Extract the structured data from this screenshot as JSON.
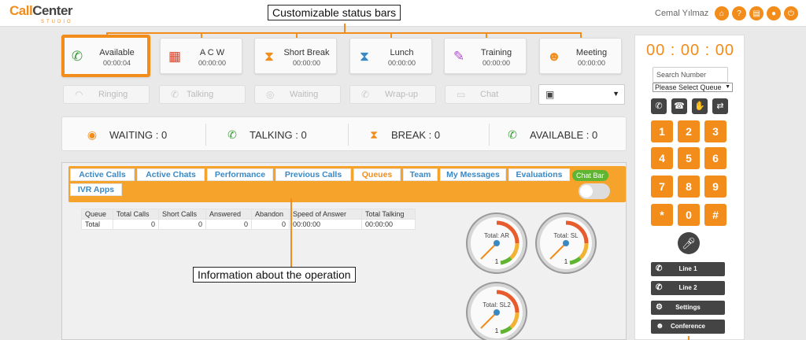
{
  "app": {
    "logo_main_a": "Call",
    "logo_main_b": "Center",
    "logo_sub": "STUDIO",
    "user_name": "Cemal Yılmaz",
    "top_icons": [
      "home-icon",
      "help-icon",
      "book-icon",
      "user-icon",
      "power-icon"
    ],
    "accent": "#f28c1a"
  },
  "annotations": {
    "status_bars": "Customizable status bars",
    "operation_info": "Information about the operation"
  },
  "status_cards": [
    {
      "label": "Available",
      "time": "00:00:04",
      "icon": "phone-icon",
      "color": "#3a9a3a",
      "selected": true
    },
    {
      "label": "A C W",
      "time": "00:00:00",
      "icon": "document-icon",
      "color": "#d9412a"
    },
    {
      "label": "Short Break",
      "time": "00:00:00",
      "icon": "hourglass-icon",
      "color": "#f28c1a"
    },
    {
      "label": "Lunch",
      "time": "00:00:00",
      "icon": "hourglass-icon",
      "color": "#3a88c4"
    },
    {
      "label": "Training",
      "time": "00:00:00",
      "icon": "pencil-icon",
      "color": "#b44bd6"
    },
    {
      "label": "Meeting",
      "time": "00:00:00",
      "icon": "group-icon",
      "color": "#f28c1a"
    }
  ],
  "call_states": [
    {
      "label": "Ringing",
      "icon": "wifi-icon"
    },
    {
      "label": "Talking",
      "icon": "phone-icon"
    },
    {
      "label": "Waiting",
      "icon": "pause-icon"
    },
    {
      "label": "Wrap-up",
      "icon": "phone-icon"
    },
    {
      "label": "Chat",
      "icon": "chat-icon"
    }
  ],
  "counters": [
    {
      "label": "WAITING : 0",
      "icon": "pause-icon",
      "color": "#f28c1a"
    },
    {
      "label": "TALKING : 0",
      "icon": "phone-in-icon",
      "color": "#3a9a3a"
    },
    {
      "label": "BREAK : 0",
      "icon": "hourglass-icon",
      "color": "#f28c1a"
    },
    {
      "label": "AVAILABLE : 0",
      "icon": "phone-icon",
      "color": "#3a9a3a"
    }
  ],
  "tabs": [
    "Active Calls",
    "Active Chats",
    "Performance",
    "Previous Calls",
    "Queues",
    "Team",
    "My Messages",
    "Evaluations",
    "IVR Apps"
  ],
  "active_tab": "Queues",
  "chat_bar_label": "Chat Bar",
  "queue_table": {
    "headers": [
      "Queue",
      "Total Calls",
      "Short Calls",
      "Answered",
      "Abandon",
      "Speed of Answer",
      "Total Talking"
    ],
    "row": [
      "Total",
      "0",
      "0",
      "0",
      "0",
      "00:00:00",
      "00:00:00"
    ]
  },
  "gauges": [
    {
      "label": "Total: AR",
      "value": "1"
    },
    {
      "label": "Total: SL",
      "value": "1"
    },
    {
      "label": "Total: SL2",
      "value": "1"
    }
  ],
  "phone": {
    "timer": "00 : 00 : 00",
    "search_placeholder": "Search Number",
    "queue_select": "Please Select Queue",
    "control_icons": [
      "phone-icon",
      "hangup-icon",
      "hand-icon",
      "transfer-icon"
    ],
    "keys": [
      "1",
      "2",
      "3",
      "4",
      "5",
      "6",
      "7",
      "8",
      "9",
      "*",
      "0",
      "#"
    ],
    "lines": [
      {
        "label": "Line 1",
        "icon": "phone-icon"
      },
      {
        "label": "Line 2",
        "icon": "phone-icon"
      },
      {
        "label": "Settings",
        "icon": "gear-icon"
      },
      {
        "label": "Conference",
        "icon": "group-icon"
      }
    ]
  }
}
